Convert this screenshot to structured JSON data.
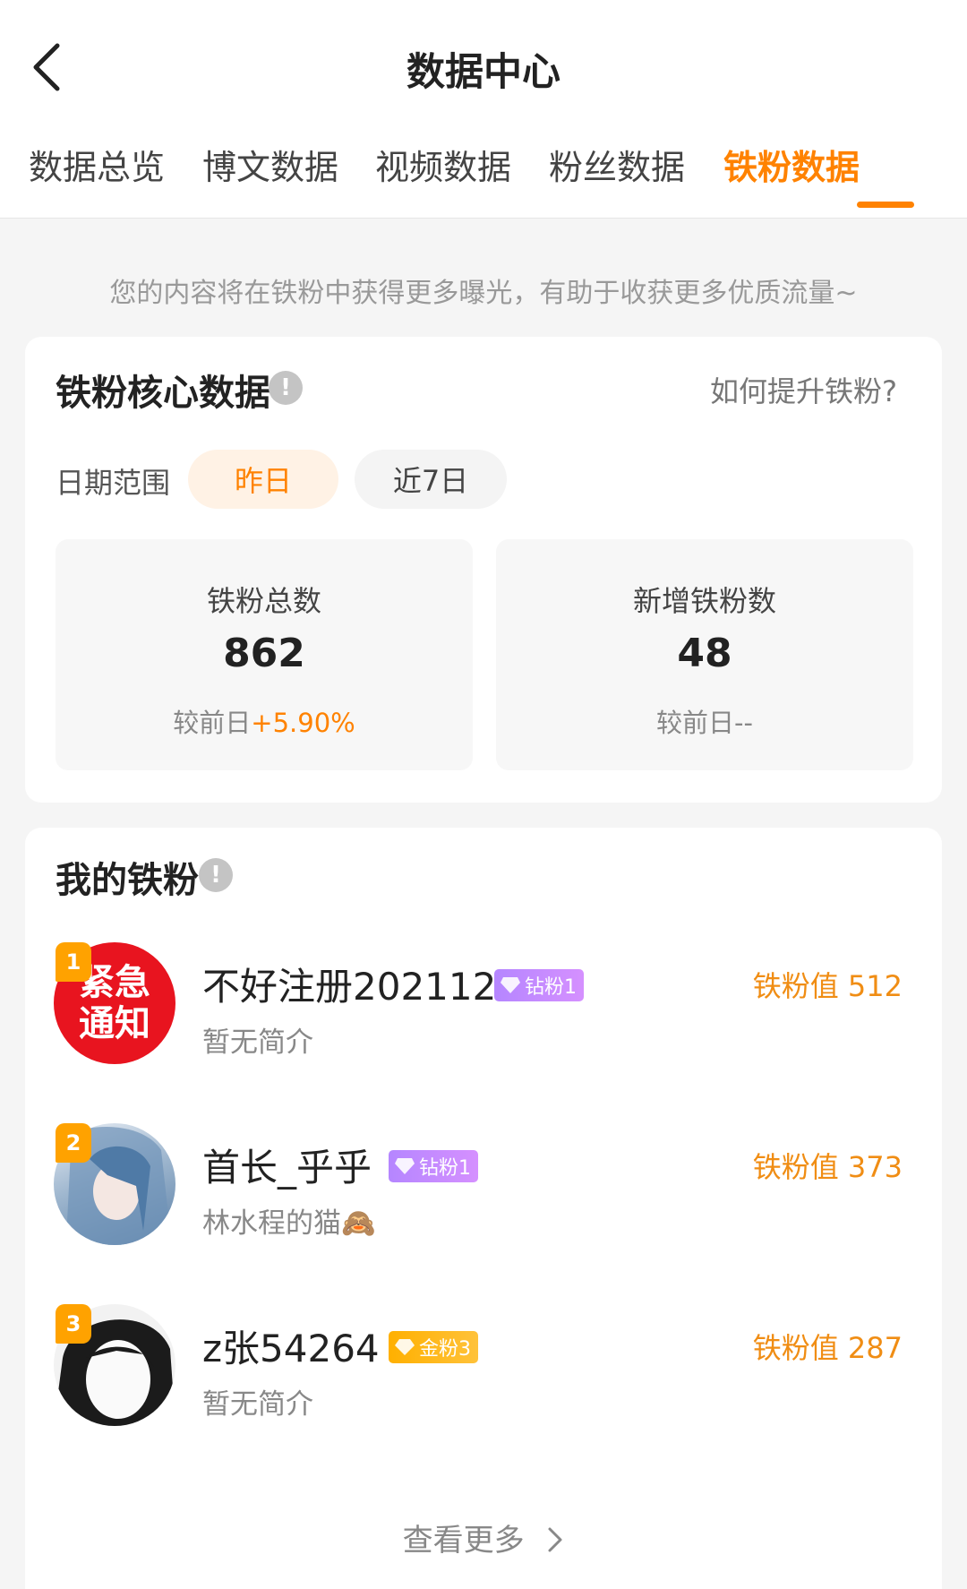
{
  "header": {
    "title": "数据中心"
  },
  "tabs": [
    "数据总览",
    "博文数据",
    "视频数据",
    "粉丝数据",
    "铁粉数据"
  ],
  "notice": "您的内容将在铁粉中获得更多曝光，有助于收获更多优质流量~",
  "core": {
    "title": "铁粉核心数据",
    "help": "如何提升铁粉?",
    "date_label": "日期范围",
    "chips": [
      "昨日",
      "近7日"
    ],
    "total": {
      "label": "铁粉总数",
      "value": "862",
      "cmp_prefix": "较前日",
      "cmp_value": "+5.90%"
    },
    "new": {
      "label": "新增铁粉数",
      "value": "48",
      "cmp": "较前日--"
    }
  },
  "fans": {
    "title": "我的铁粉",
    "list": [
      {
        "rank": "1",
        "name": "不好注册202112",
        "tag": "钻粉1",
        "bio": "暂无简介",
        "score": "铁粉值 512",
        "avatar_text": [
          "紧急",
          "通知"
        ]
      },
      {
        "rank": "2",
        "name": "首长_乎乎",
        "tag": "钻粉1",
        "bio": "林水程的猫🙈",
        "score": "铁粉值 373"
      },
      {
        "rank": "3",
        "name": "z张54264",
        "tag": "金粉3",
        "bio": "暂无简介",
        "score": "铁粉值 287"
      }
    ],
    "see_more": "查看更多"
  },
  "colors": {
    "accent": "#ff8200",
    "diamond_tag": "#b586ff",
    "gold_tag": "#ffb000",
    "avatar_red": "#e8141f"
  },
  "icons": [
    "chevron-left-icon",
    "info-icon",
    "diamond-icon",
    "gem-icon",
    "chevron-right-icon"
  ]
}
